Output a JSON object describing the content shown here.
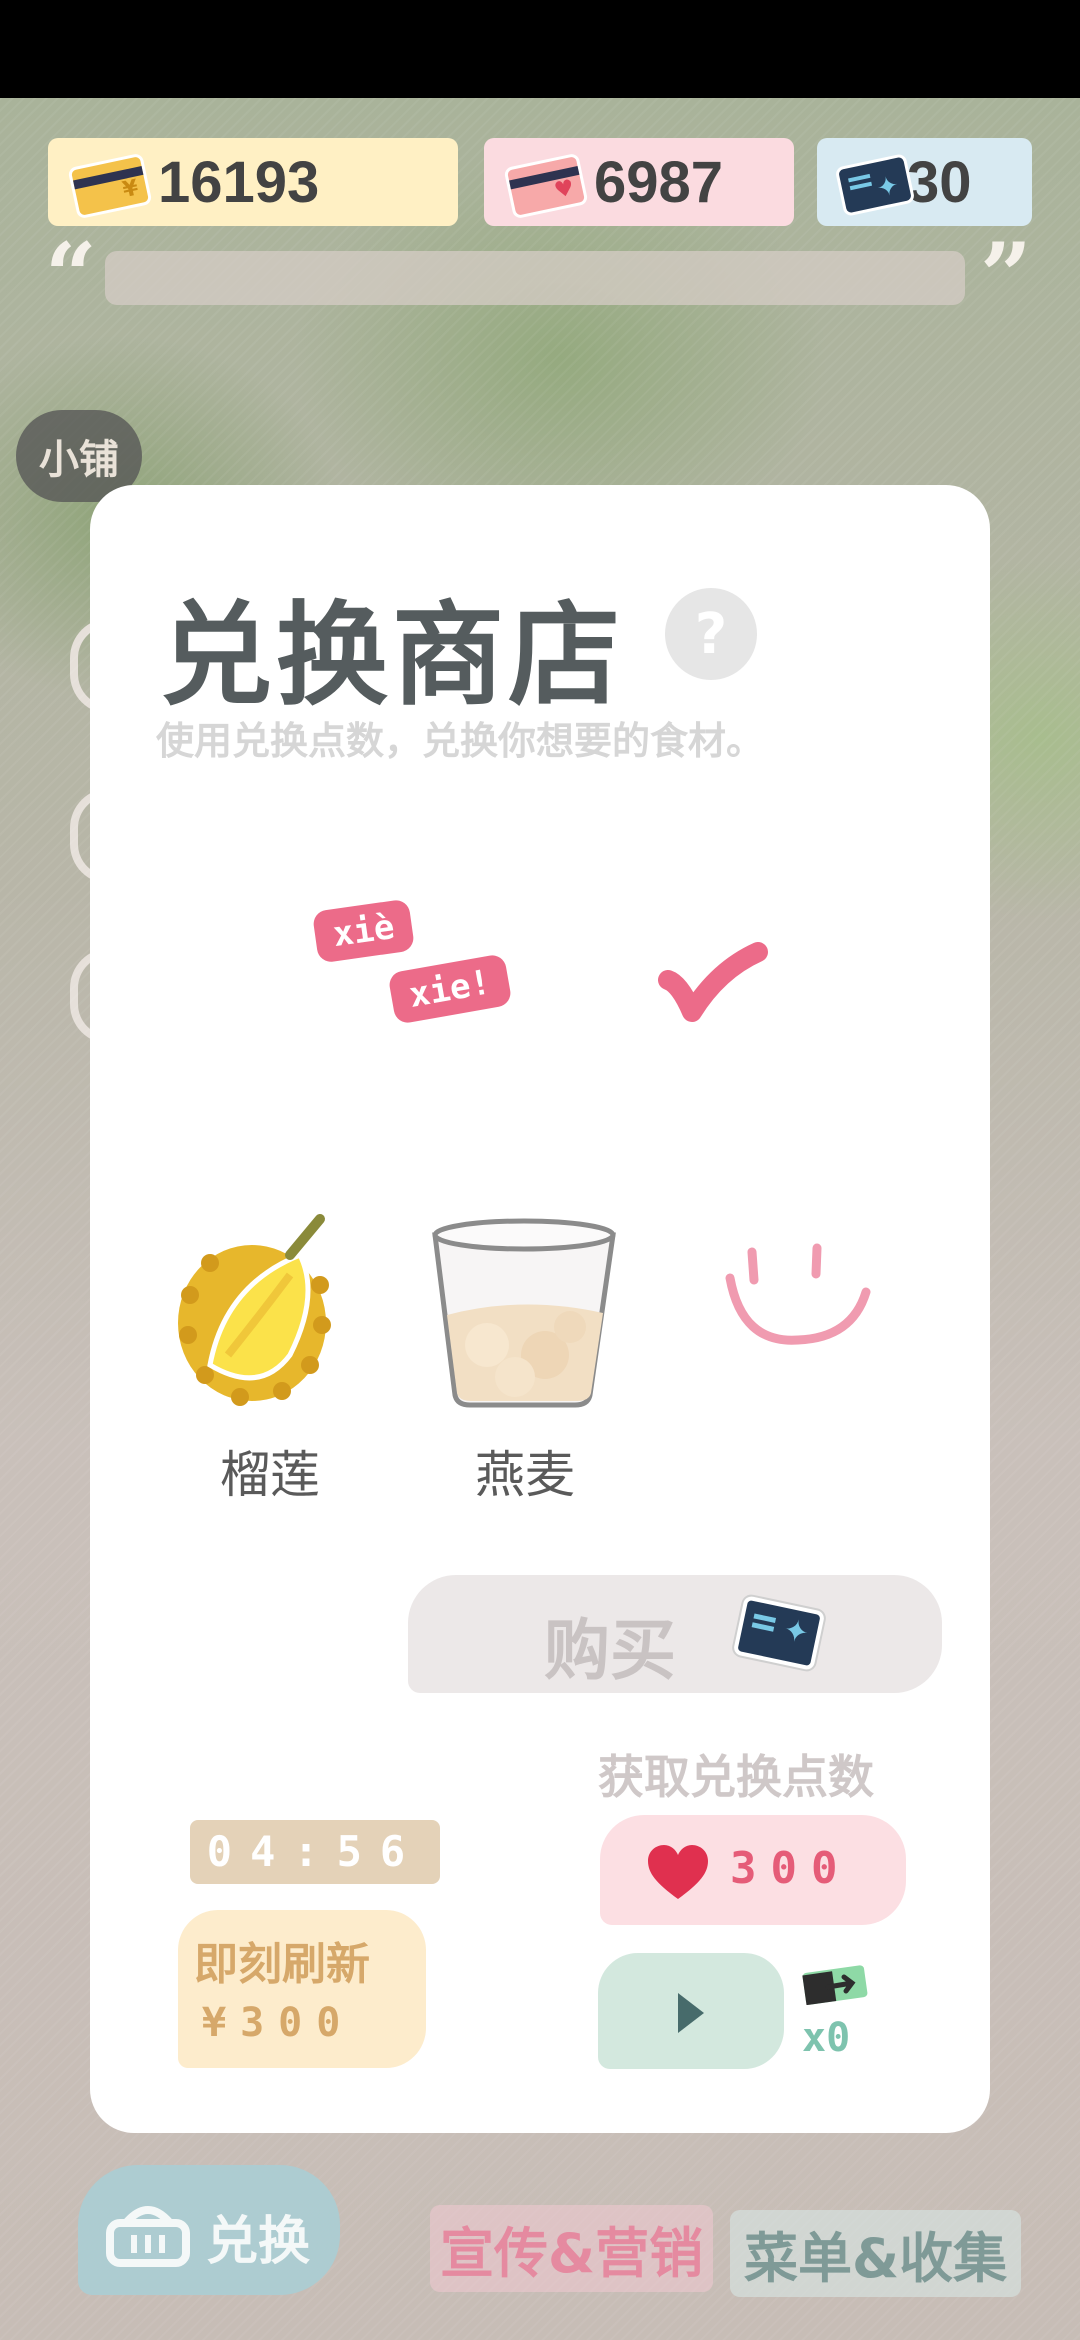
{
  "currency": {
    "gold": "16193",
    "hearts": "6987",
    "tickets": "30"
  },
  "shop_tag": "小铺",
  "modal": {
    "title": "兑换商店",
    "help_symbol": "?",
    "subtitle": "使用兑换点数，兑换你想要的食材。",
    "sticker_words": [
      "xiè",
      "xie!"
    ],
    "items": [
      {
        "label": "榴莲",
        "icon": "durian-icon"
      },
      {
        "label": "燕麦",
        "icon": "oat-cup-icon"
      }
    ],
    "buy_label": "购买",
    "earn_title": "获取兑换点数",
    "earn_heart_amount": "300",
    "ticket_count": "x0",
    "timer": "04:56",
    "refresh_label": "即刻刷新",
    "refresh_cost": "¥300"
  },
  "tabs": {
    "exchange": "兑换",
    "promo": "宣传&营销",
    "menu": "菜单&收集"
  },
  "colors": {
    "heart": "#e0445b",
    "accent_pink": "#ec6b89",
    "ticket_dark": "#243a56",
    "refresh_bg": "#fdeccc"
  }
}
